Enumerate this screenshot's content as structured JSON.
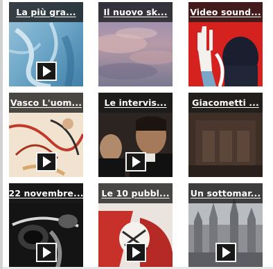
{
  "colors": {
    "caption_bg": "#191919",
    "caption_text": "#ffffff",
    "play_bg": "#181818",
    "play_border": "#f4f4f4"
  },
  "play_icon": "play-icon",
  "videos": [
    {
      "title": "La più gra..."
    },
    {
      "title": "Il nuovo sk..."
    },
    {
      "title": "Video sound..."
    },
    {
      "title": "Vasco L'uom..."
    },
    {
      "title": "Le intervis..."
    },
    {
      "title": "Giacometti ..."
    },
    {
      "title": "22 novembre..."
    },
    {
      "title": "Le 10 pubbl..."
    },
    {
      "title": "Un sottomar..."
    }
  ]
}
